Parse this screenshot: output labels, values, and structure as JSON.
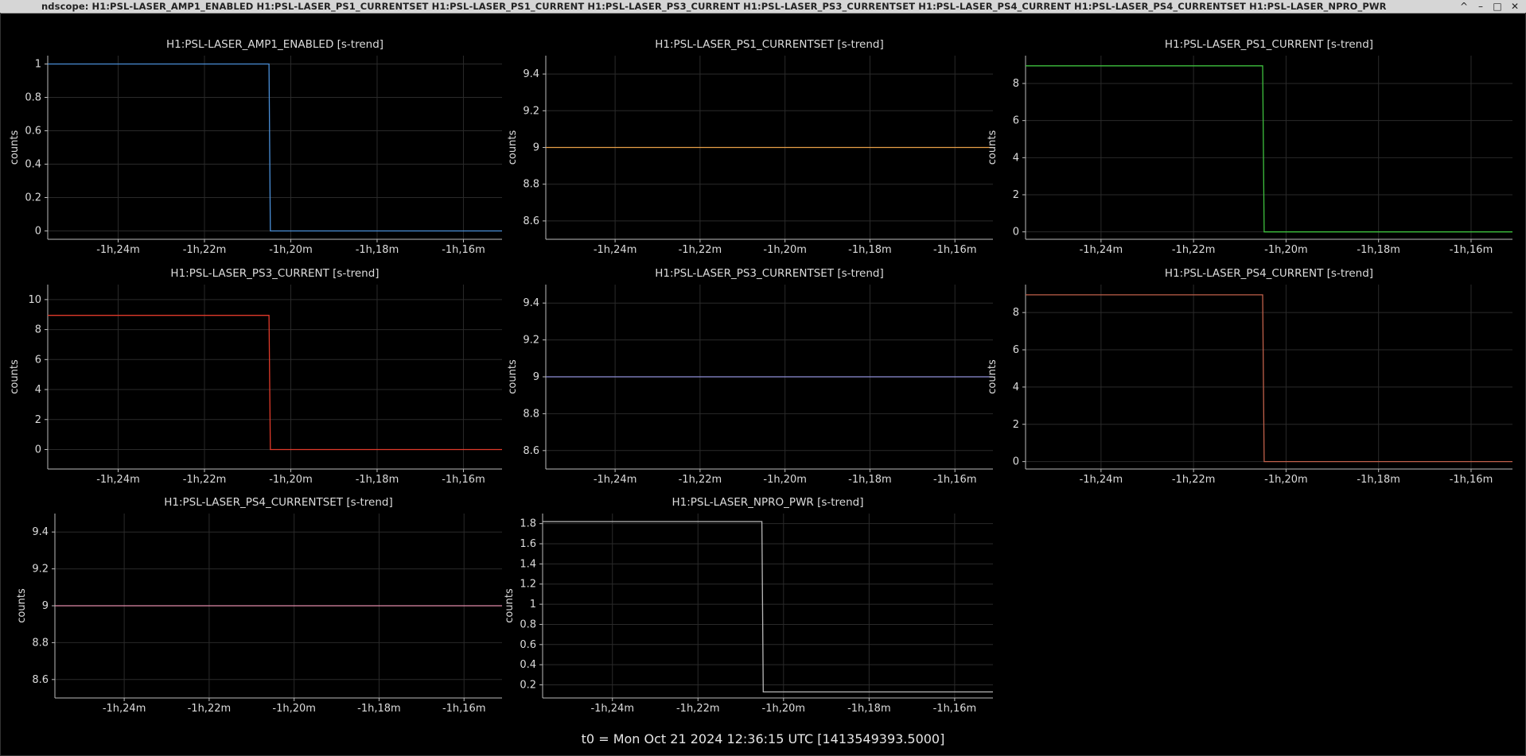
{
  "window": {
    "title": "ndscope: H1:PSL-LASER_AMP1_ENABLED H1:PSL-LASER_PS1_CURRENTSET H1:PSL-LASER_PS1_CURRENT H1:PSL-LASER_PS3_CURRENT H1:PSL-LASER_PS3_CURRENTSET H1:PSL-LASER_PS4_CURRENT H1:PSL-LASER_PS4_CURRENTSET H1:PSL-LASER_NPRO_PWR",
    "buttons": [
      "^",
      "–",
      "□",
      "✕"
    ]
  },
  "footer": {
    "t0": "t0 = Mon Oct 21 2024 12:36:15 UTC [1413549393.5000]"
  },
  "colors": {
    "background": "#000000",
    "grid": "#2a2a2a",
    "axis": "#bbbbbb"
  },
  "chart_data": [
    {
      "type": "line",
      "title": "H1:PSL-LASER_AMP1_ENABLED [s-trend]",
      "ylabel": "counts",
      "color": "#4a8fd8",
      "xticks": [
        "-1h,24m",
        "-1h,22m",
        "-1h,20m",
        "-1h,18m",
        "-1h,16m"
      ],
      "yticks": [
        "0",
        "0.2",
        "0.4",
        "0.6",
        "0.8",
        "1"
      ],
      "ylim": [
        -0.05,
        1.05
      ],
      "series": [
        {
          "x": [
            0,
            0.487,
            0.49,
            1
          ],
          "y": [
            1,
            1,
            0,
            0
          ]
        }
      ]
    },
    {
      "type": "line",
      "title": "H1:PSL-LASER_PS1_CURRENTSET [s-trend]",
      "ylabel": "counts",
      "color": "#e8a048",
      "xticks": [
        "-1h,24m",
        "-1h,22m",
        "-1h,20m",
        "-1h,18m",
        "-1h,16m"
      ],
      "yticks": [
        "8.6",
        "8.8",
        "9",
        "9.2",
        "9.4"
      ],
      "ylim": [
        8.5,
        9.5
      ],
      "series": [
        {
          "x": [
            0,
            1
          ],
          "y": [
            9,
            9
          ]
        }
      ]
    },
    {
      "type": "line",
      "title": "H1:PSL-LASER_PS1_CURRENT [s-trend]",
      "ylabel": "counts",
      "color": "#3ec03e",
      "xticks": [
        "-1h,24m",
        "-1h,22m",
        "-1h,20m",
        "-1h,18m",
        "-1h,16m"
      ],
      "yticks": [
        "0",
        "2",
        "4",
        "6",
        "8"
      ],
      "ylim": [
        -0.4,
        9.5
      ],
      "series": [
        {
          "x": [
            0,
            0.487,
            0.49,
            1
          ],
          "y": [
            8.95,
            8.95,
            0,
            0
          ]
        }
      ]
    },
    {
      "type": "line",
      "title": "H1:PSL-LASER_PS3_CURRENT [s-trend]",
      "ylabel": "counts",
      "color": "#e03a2a",
      "xticks": [
        "-1h,24m",
        "-1h,22m",
        "-1h,20m",
        "-1h,18m",
        "-1h,16m"
      ],
      "yticks": [
        "0",
        "2",
        "4",
        "6",
        "8",
        "10"
      ],
      "ylim": [
        -1.3,
        11
      ],
      "series": [
        {
          "x": [
            0,
            0.487,
            0.49,
            1
          ],
          "y": [
            8.95,
            8.95,
            0,
            0
          ]
        }
      ]
    },
    {
      "type": "line",
      "title": "H1:PSL-LASER_PS3_CURRENTSET [s-trend]",
      "ylabel": "counts",
      "color": "#8f8fd8",
      "xticks": [
        "-1h,24m",
        "-1h,22m",
        "-1h,20m",
        "-1h,18m",
        "-1h,16m"
      ],
      "yticks": [
        "8.6",
        "8.8",
        "9",
        "9.2",
        "9.4"
      ],
      "ylim": [
        8.5,
        9.5
      ],
      "series": [
        {
          "x": [
            0,
            1
          ],
          "y": [
            9,
            9
          ]
        }
      ]
    },
    {
      "type": "line",
      "title": "H1:PSL-LASER_PS4_CURRENT [s-trend]",
      "ylabel": "counts",
      "color": "#c0604a",
      "xticks": [
        "-1h,24m",
        "-1h,22m",
        "-1h,20m",
        "-1h,18m",
        "-1h,16m"
      ],
      "yticks": [
        "0",
        "2",
        "4",
        "6",
        "8"
      ],
      "ylim": [
        -0.4,
        9.5
      ],
      "series": [
        {
          "x": [
            0,
            0.487,
            0.49,
            1
          ],
          "y": [
            8.95,
            8.95,
            0,
            0
          ]
        }
      ]
    },
    {
      "type": "line",
      "title": "H1:PSL-LASER_PS4_CURRENTSET [s-trend]",
      "ylabel": "counts",
      "color": "#e08aa8",
      "xticks": [
        "-1h,24m",
        "-1h,22m",
        "-1h,20m",
        "-1h,18m",
        "-1h,16m"
      ],
      "yticks": [
        "8.6",
        "8.8",
        "9",
        "9.2",
        "9.4"
      ],
      "ylim": [
        8.5,
        9.5
      ],
      "series": [
        {
          "x": [
            0,
            1
          ],
          "y": [
            9,
            9
          ]
        }
      ]
    },
    {
      "type": "line",
      "title": "H1:PSL-LASER_NPRO_PWR [s-trend]",
      "ylabel": "counts",
      "color": "#b8b8b8",
      "xticks": [
        "-1h,24m",
        "-1h,22m",
        "-1h,20m",
        "-1h,18m",
        "-1h,16m"
      ],
      "yticks": [
        "0.2",
        "0.4",
        "0.6",
        "0.8",
        "1",
        "1.2",
        "1.4",
        "1.6",
        "1.8"
      ],
      "ylim": [
        0.07,
        1.9
      ],
      "series": [
        {
          "x": [
            0,
            0.487,
            0.49,
            1
          ],
          "y": [
            1.82,
            1.82,
            0.13,
            0.13
          ]
        }
      ]
    }
  ]
}
